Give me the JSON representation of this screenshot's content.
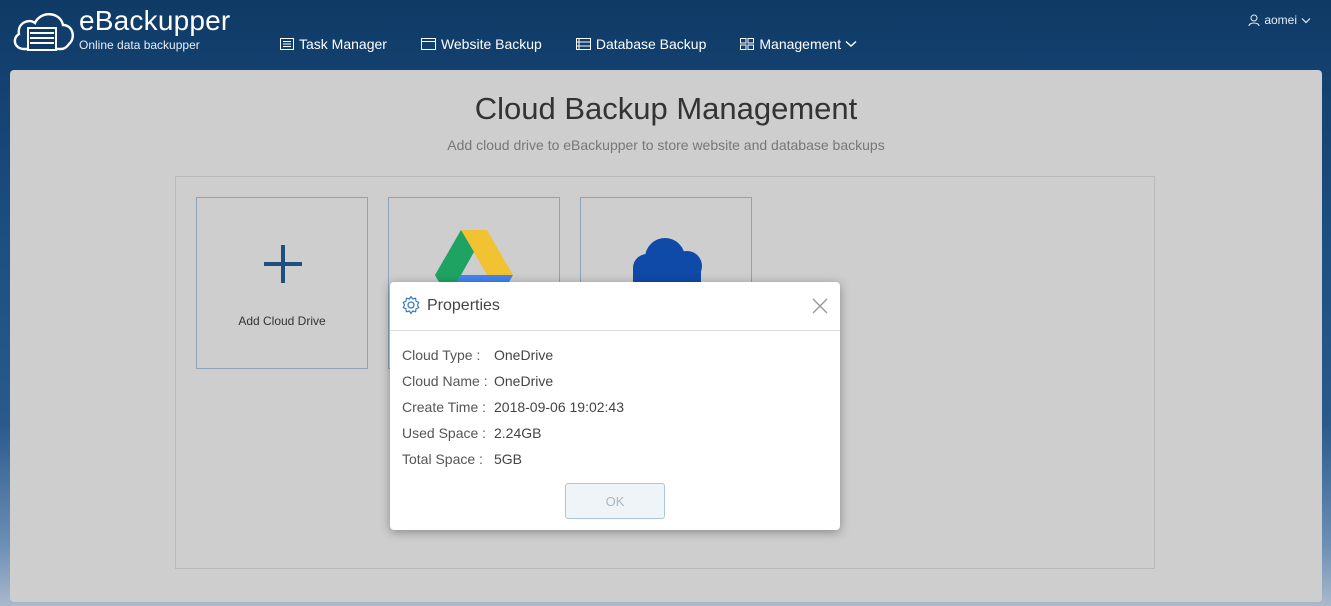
{
  "brand": {
    "name": "eBackupper",
    "subtitle": "Online data backupper"
  },
  "nav": {
    "items": [
      {
        "label": "Task Manager",
        "icon": "list-icon"
      },
      {
        "label": "Website Backup",
        "icon": "window-icon"
      },
      {
        "label": "Database Backup",
        "icon": "database-list-icon"
      },
      {
        "label": "Management",
        "icon": "grid-icon"
      }
    ]
  },
  "user": {
    "name": "aomei"
  },
  "page": {
    "title": "Cloud Backup Management",
    "subtitle": "Add cloud drive to eBackupper to store website and database backups"
  },
  "cards": [
    {
      "label": "Add Cloud Drive",
      "icon": "plus-icon"
    },
    {
      "label": "",
      "icon": "google-drive-icon"
    },
    {
      "label": "",
      "icon": "onedrive-icon"
    }
  ],
  "dialog": {
    "title": "Properties",
    "rows": [
      {
        "key": "Cloud Type :",
        "value": "OneDrive"
      },
      {
        "key": "Cloud Name :",
        "value": "OneDrive"
      },
      {
        "key": "Create Time :",
        "value": "2018-09-06 19:02:43"
      },
      {
        "key": "Used Space :",
        "value": "2.24GB"
      },
      {
        "key": "Total Space :",
        "value": "5GB"
      }
    ],
    "ok_label": "OK"
  },
  "colors": {
    "accent": "#1e4f7d",
    "header": "#0f3a66",
    "panel": "#cecece"
  }
}
